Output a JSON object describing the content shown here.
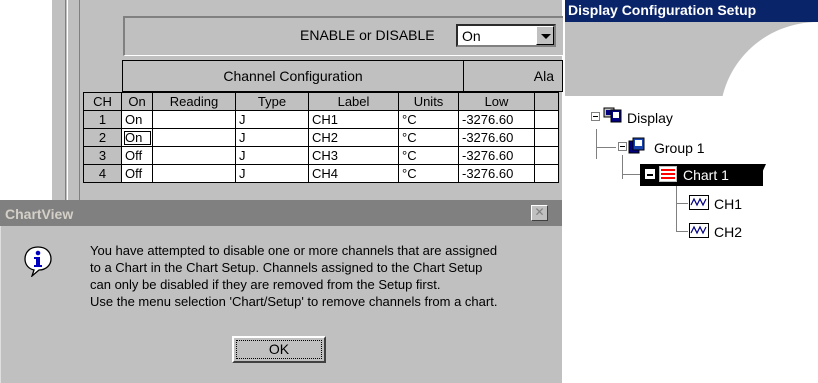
{
  "enable": {
    "label": "ENABLE or DISABLE",
    "value": "On"
  },
  "sections": {
    "channel_config": "Channel Configuration",
    "alarm": "Ala"
  },
  "table": {
    "headers": [
      "CH",
      "On",
      "Reading",
      "Type",
      "Label",
      "Units",
      "Low"
    ],
    "rows": [
      [
        "1",
        "On",
        "",
        "J",
        "CH1",
        "°C",
        "-3276.60"
      ],
      [
        "2",
        "On",
        "",
        "J",
        "CH2",
        "°C",
        "-3276.60"
      ],
      [
        "3",
        "Off",
        "",
        "J",
        "CH3",
        "°C",
        "-3276.60"
      ],
      [
        "4",
        "Off",
        "",
        "J",
        "CH4",
        "°C",
        "-3276.60"
      ]
    ]
  },
  "tree": {
    "title": "Display Configuration  Setup",
    "nodes": {
      "display": "Display",
      "group": "Group 1",
      "chart": "Chart 1",
      "ch1": "CH1",
      "ch2": "CH2"
    },
    "icons": [
      "display-icon",
      "group-icon",
      "chart-icon",
      "channel-icon"
    ]
  },
  "dialog": {
    "title": "ChartView",
    "icon": "info-icon",
    "lines": [
      "You have attempted to disable one or more channels that are assigned",
      "to a Chart in the Chart Setup.  Channels assigned to the Chart Setup",
      "can only be disabled if they are removed from the Setup first.",
      "Use the menu selection 'Chart/Setup' to remove channels from a chart."
    ],
    "ok_label": "OK"
  },
  "colors": {
    "title_active": "#0a246a",
    "title_inactive": "#808080",
    "face": "#c0c0c0"
  }
}
